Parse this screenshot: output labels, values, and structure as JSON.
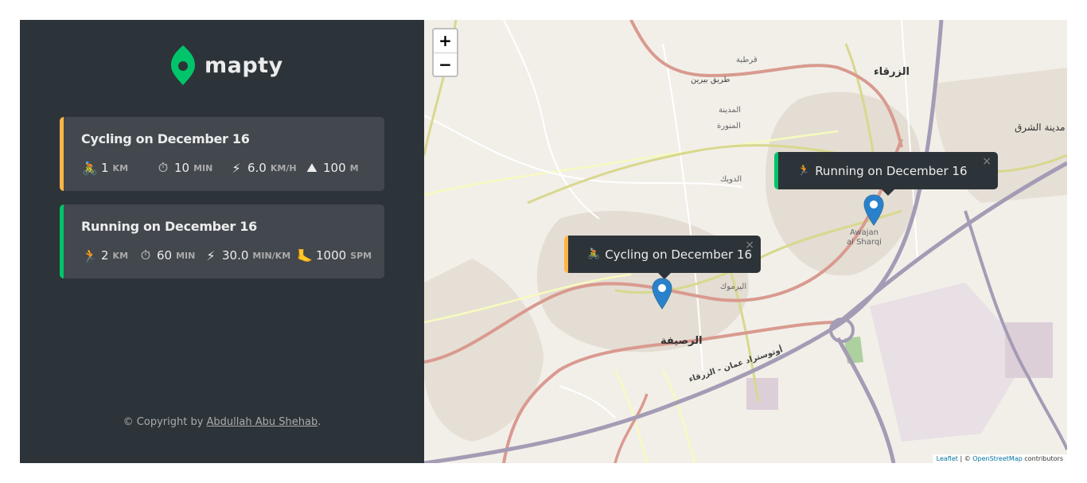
{
  "app": {
    "logo_text": "mapty"
  },
  "workouts": [
    {
      "type": "cycling",
      "title": "Cycling on December 16",
      "color": "#ffb545",
      "details": [
        {
          "icon": "bicycle-icon",
          "emoji": "🚴",
          "value": "1",
          "unit": "km"
        },
        {
          "icon": "stopwatch-icon",
          "emoji": "⏱",
          "value": "10",
          "unit": "min"
        },
        {
          "icon": "lightning-icon",
          "emoji": "⚡",
          "value": "6.0",
          "unit": "km/h"
        },
        {
          "icon": "mountain-icon",
          "emoji": "⛰",
          "value": "100",
          "unit": "m"
        }
      ]
    },
    {
      "type": "running",
      "title": "Running on December 16",
      "color": "#00c46a",
      "details": [
        {
          "icon": "runner-icon",
          "emoji": "🏃",
          "value": "2",
          "unit": "km"
        },
        {
          "icon": "stopwatch-icon",
          "emoji": "⏱",
          "value": "60",
          "unit": "min"
        },
        {
          "icon": "lightning-icon",
          "emoji": "⚡",
          "value": "30.0",
          "unit": "min/km"
        },
        {
          "icon": "foot-icon",
          "emoji": "🦶",
          "value": "1000",
          "unit": "spm"
        }
      ]
    }
  ],
  "copyright": {
    "prefix": "© Copyright by ",
    "author": "Abdullah Abu Shehab",
    "suffix": "."
  },
  "map": {
    "zoom_in": "+",
    "zoom_out": "−",
    "popups": {
      "running": {
        "emoji": "🏃",
        "text": "Running on December 16",
        "close": "×"
      },
      "cycling": {
        "emoji": "🚴",
        "text": "Cycling on December 16",
        "close": "×"
      }
    },
    "labels": {
      "zarqa": "الزرقاء",
      "rusaifa": "الرصيفة",
      "awajan": "Awajan",
      "sharqi": "al Sharqi",
      "madinat_sharq": "مدينة الشرق",
      "yarmouk": "اليرموك",
      "medina": "المدينة",
      "munawara": "المنورة",
      "duwaik": "الدويك",
      "qurtuba": "قرطبة",
      "bayreen": "طريق بيرين",
      "autostrad": "أوتوستراد عمان - الزرقاء"
    },
    "attribution": {
      "leaflet": "Leaflet",
      "sep": " | © ",
      "osm": "OpenStreetMap",
      "suffix": " contributors"
    }
  }
}
